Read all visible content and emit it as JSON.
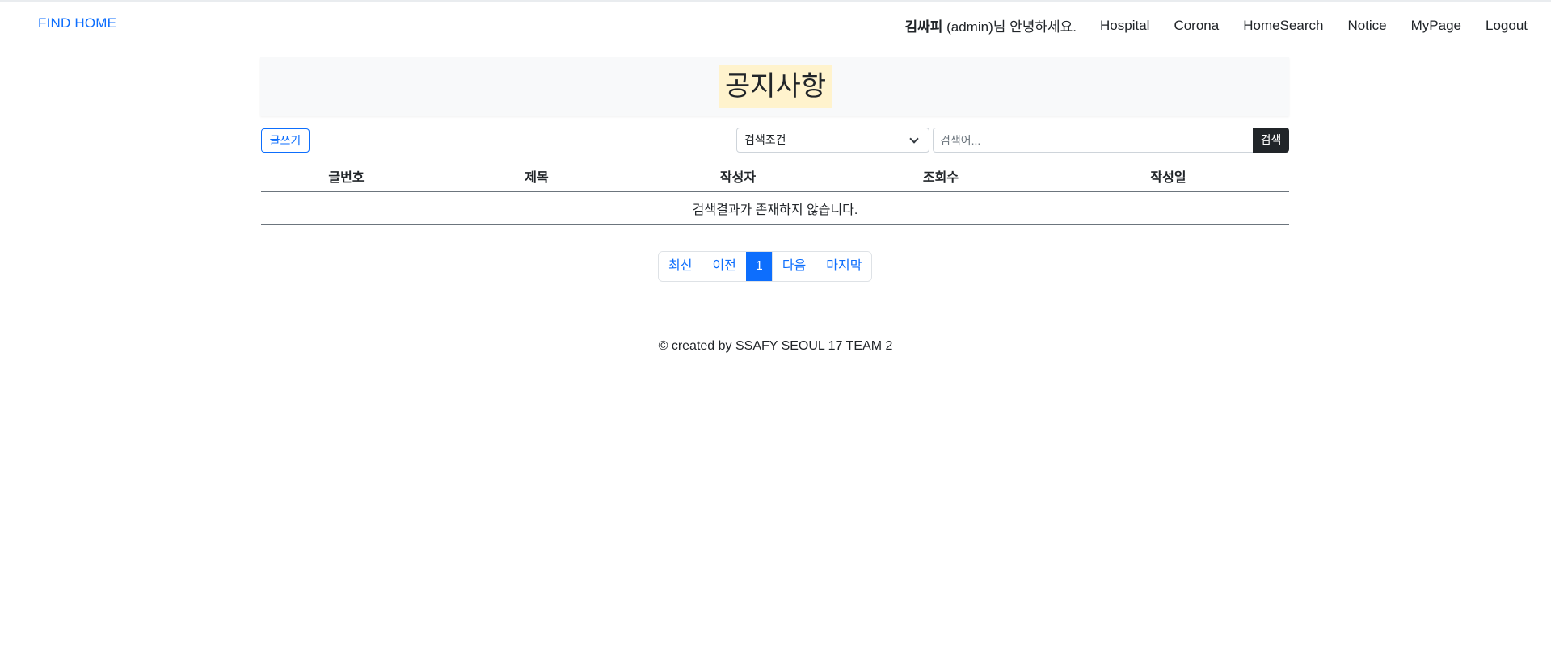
{
  "navbar": {
    "brand": "FIND HOME",
    "user_name": "김싸피",
    "user_suffix": "(admin)님 안녕하세요.",
    "links": [
      "Hospital",
      "Corona",
      "HomeSearch",
      "Notice",
      "MyPage",
      "Logout"
    ]
  },
  "page": {
    "title": "공지사항"
  },
  "toolbar": {
    "write_label": "글쓰기",
    "search_condition": "검색조건",
    "search_placeholder": "검색어...",
    "search_label": "검색"
  },
  "table": {
    "headers": [
      "글번호",
      "제목",
      "작성자",
      "조회수",
      "작성일"
    ],
    "empty_message": "검색결과가 존재하지 않습니다."
  },
  "pagination": {
    "first": "최신",
    "prev": "이전",
    "current": "1",
    "next": "다음",
    "last": "마지막"
  },
  "footer": {
    "text": "© created by SSAFY SEOUL 17 TEAM 2"
  },
  "colors": {
    "primary": "#0d6efd",
    "dark": "#212529",
    "title_highlight": "#fff3cd"
  }
}
